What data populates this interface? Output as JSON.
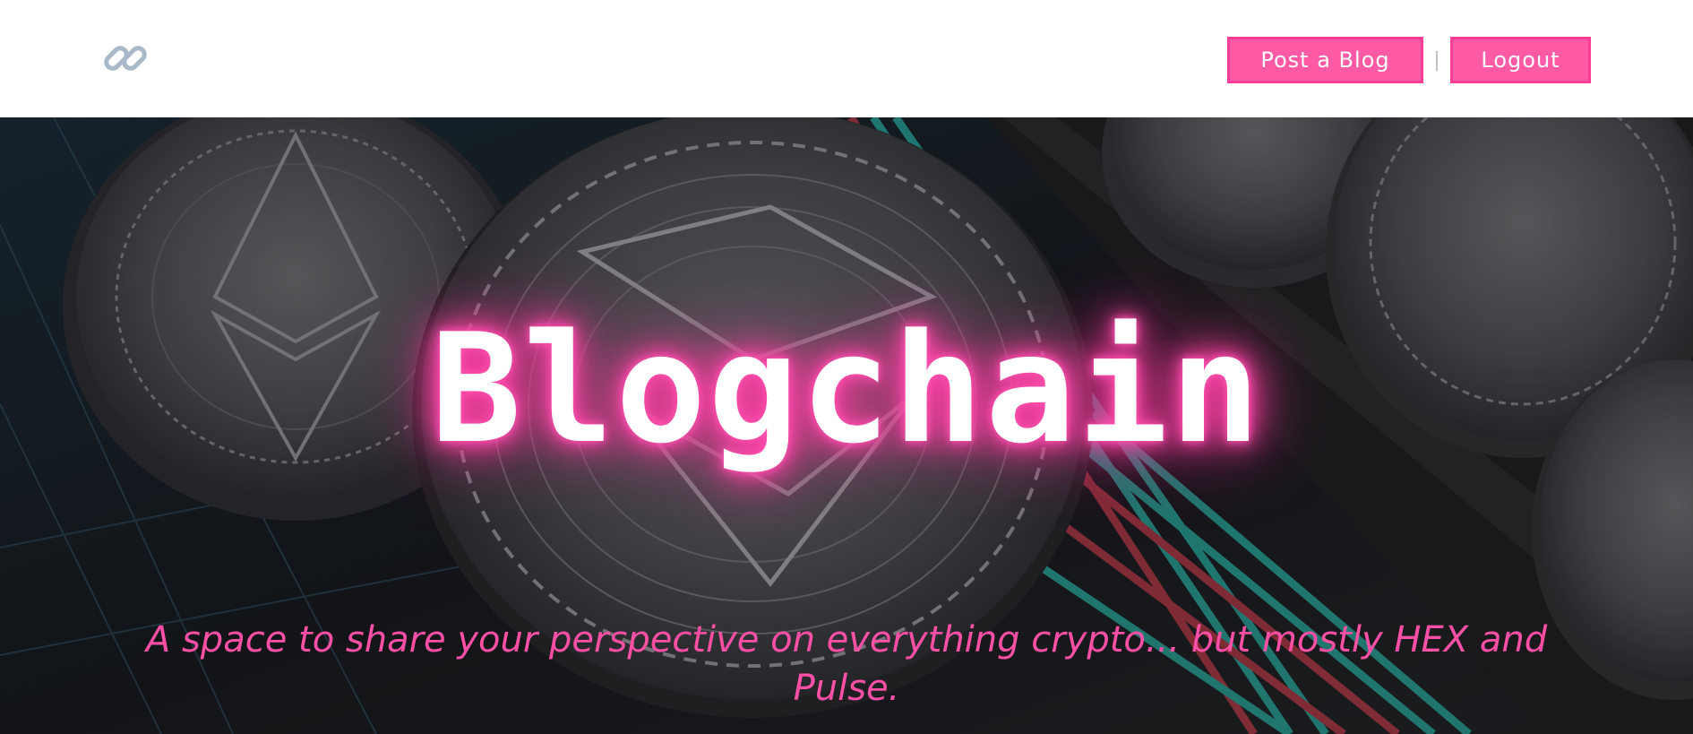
{
  "header": {
    "logo_icon": "link-icon",
    "post_button_label": "Post a Blog",
    "separator": "|",
    "logout_button_label": "Logout"
  },
  "hero": {
    "title": "Blogchain",
    "tagline": "A space to share your perspective on everything crypto... but mostly HEX and Pulse."
  },
  "colors": {
    "accent": "#ff5aa5",
    "accent_border": "#ff3d96",
    "tagline": "#ff4fa6",
    "title_glow": "#ff4fb0",
    "header_bg": "#ffffff",
    "logo": "#a9b9c9"
  }
}
